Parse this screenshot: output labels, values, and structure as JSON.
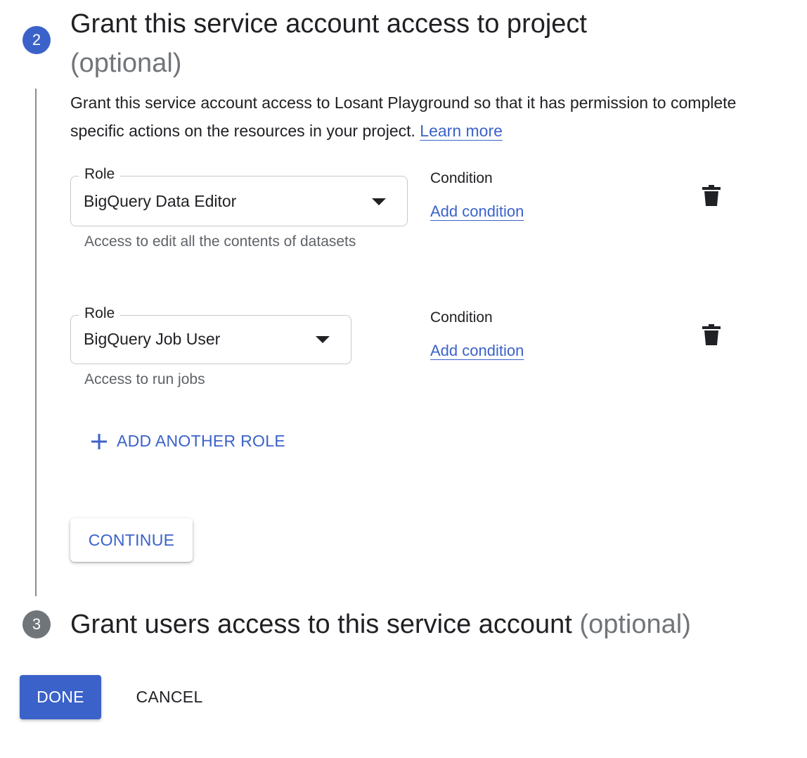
{
  "step2": {
    "number": "2",
    "title": "Grant this service account access to project",
    "optional": "(optional)",
    "description": "Grant this service account access to Losant Playground so that it has permission to complete specific actions on the resources in your project.",
    "learn_more": "Learn more"
  },
  "roles": [
    {
      "label": "Role",
      "value": "BigQuery Data Editor",
      "hint": "Access to edit all the contents of datasets",
      "condition_label": "Condition",
      "add_condition": "Add condition"
    },
    {
      "label": "Role",
      "value": "BigQuery Job User",
      "hint": "Access to run jobs",
      "condition_label": "Condition",
      "add_condition": "Add condition"
    }
  ],
  "add_another_role": "ADD ANOTHER ROLE",
  "continue_label": "CONTINUE",
  "step3": {
    "number": "3",
    "title": "Grant users access to this service account",
    "optional": "(optional)"
  },
  "footer": {
    "done_label": "DONE",
    "cancel_label": "CANCEL"
  },
  "colors": {
    "accent": "#3b62c9",
    "muted": "#70757a"
  }
}
